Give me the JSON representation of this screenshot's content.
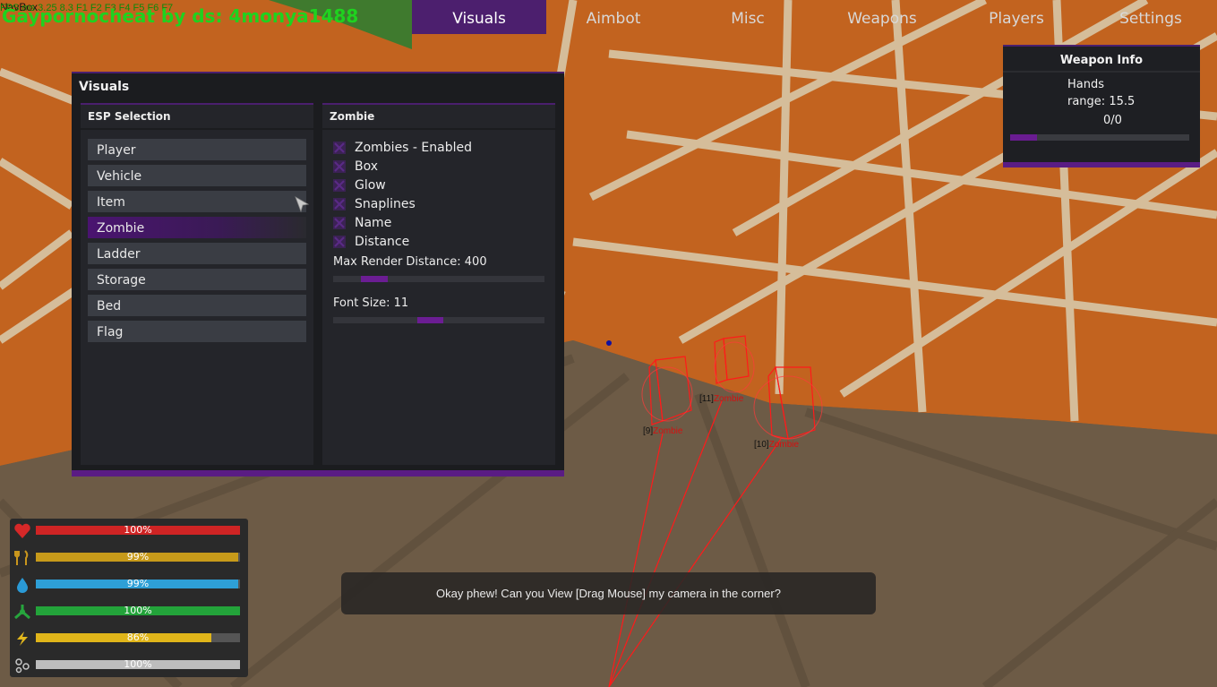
{
  "overlay": {
    "debug_line": "FPS  ms 3.25 8.3 F1 F2 F3 F4 F5 F6 F7",
    "navbox_label": "NavBox",
    "watermark": "Gaypornocheat by ds: 4monya1488"
  },
  "top_tabs": [
    {
      "label": "Visuals",
      "active": true
    },
    {
      "label": "Aimbot",
      "active": false
    },
    {
      "label": "Misc",
      "active": false
    },
    {
      "label": "Weapons",
      "active": false
    },
    {
      "label": "Players",
      "active": false
    },
    {
      "label": "Settings",
      "active": false
    }
  ],
  "visuals_panel": {
    "title": "Visuals",
    "esp_selection": {
      "title": "ESP Selection",
      "items": [
        "Player",
        "Vehicle",
        "Item",
        "Zombie",
        "Ladder",
        "Storage",
        "Bed",
        "Flag"
      ],
      "selected": "Zombie"
    },
    "zombie": {
      "title": "Zombie",
      "toggles": [
        {
          "label": "Zombies - Enabled",
          "checked": true
        },
        {
          "label": "Box",
          "checked": true
        },
        {
          "label": "Glow",
          "checked": true
        },
        {
          "label": "Snaplines",
          "checked": true
        },
        {
          "label": "Name",
          "checked": true
        },
        {
          "label": "Distance",
          "checked": true
        }
      ],
      "max_render_distance": {
        "label": "Max Render Distance: 400",
        "fill_fraction": 0.13
      },
      "font_size": {
        "label": "Font Size: 11",
        "fill_fraction": 0.12
      }
    }
  },
  "weapon_info": {
    "title": "Weapon Info",
    "name": "Hands",
    "range": "range: 15.5",
    "ammo": "0/0",
    "bar_fraction": 0.15
  },
  "status": [
    {
      "icon": "heart-icon",
      "value": "100%",
      "fraction": 1.0,
      "color": "#cf2424",
      "icon_color": "#d62828"
    },
    {
      "icon": "food-icon",
      "value": "99%",
      "fraction": 0.99,
      "color": "#c79a1a",
      "icon_color": "#c9961d"
    },
    {
      "icon": "water-icon",
      "value": "99%",
      "fraction": 0.99,
      "color": "#2e9fd6",
      "icon_color": "#2a9ad6"
    },
    {
      "icon": "radiation-icon",
      "value": "100%",
      "fraction": 1.0,
      "color": "#23a33a",
      "icon_color": "#27a53d"
    },
    {
      "icon": "stamina-icon",
      "value": "86%",
      "fraction": 0.86,
      "color": "#e0b51a",
      "icon_color": "#e3b81d"
    },
    {
      "icon": "oxygen-icon",
      "value": "100%",
      "fraction": 1.0,
      "color": "#bdbdbd",
      "icon_color": "#c8c8c8"
    }
  ],
  "hint": "Okay phew! Can you View [Drag Mouse] my camera in the corner?",
  "zombies": [
    {
      "num": "[11]",
      "name": "Zombie"
    },
    {
      "num": "[9]",
      "name": "Zombie"
    },
    {
      "num": "[10]",
      "name": "Zombie"
    }
  ],
  "colors": {
    "accent_purple": "#5a1c84",
    "active_tab": "#4c1f6e",
    "esp_red": "#ff1a1a"
  }
}
